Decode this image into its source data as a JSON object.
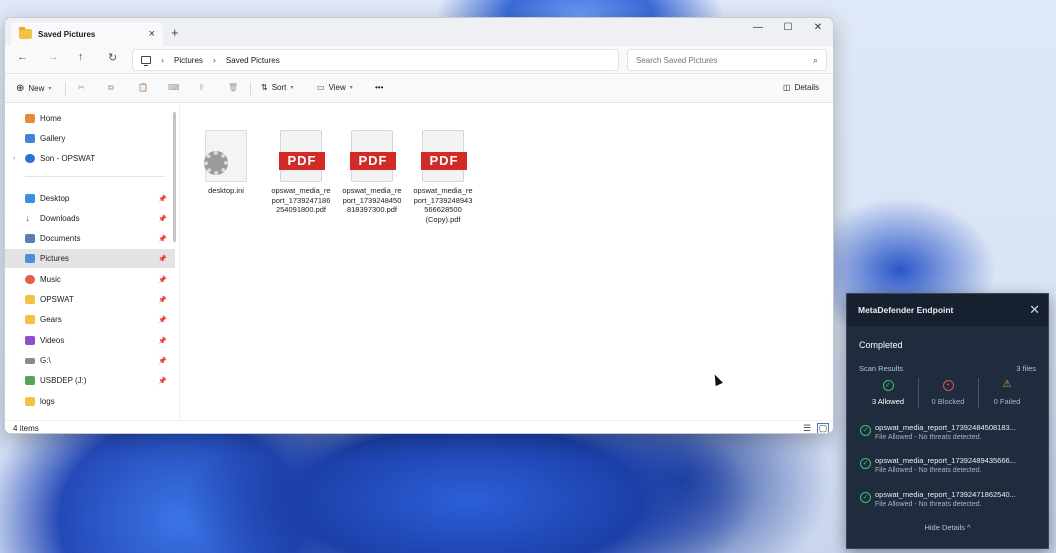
{
  "explorer": {
    "tab_title": "Saved Pictures",
    "new_tab_symbol": "+",
    "breadcrumb": [
      "Pictures",
      "Saved Pictures"
    ],
    "search_placeholder": "Search Saved Pictures",
    "toolbar": {
      "new_label": "New",
      "sort_label": "Sort",
      "view_label": "View",
      "more_label": "•••",
      "details_label": "Details"
    },
    "sidebar": {
      "top_items": [
        {
          "label": "Home",
          "icon": "home-icon"
        },
        {
          "label": "Gallery",
          "icon": "gallery-icon"
        },
        {
          "label": "Son - OPSWAT",
          "icon": "onedrive-cloud-icon"
        }
      ],
      "pinned_items": [
        {
          "label": "Desktop",
          "icon": "desktop-icon"
        },
        {
          "label": "Downloads",
          "icon": "download-icon"
        },
        {
          "label": "Documents",
          "icon": "documents-icon"
        },
        {
          "label": "Pictures",
          "icon": "pictures-icon"
        },
        {
          "label": "Music",
          "icon": "music-icon"
        },
        {
          "label": "OPSWAT",
          "icon": "folder-icon"
        },
        {
          "label": "Gears",
          "icon": "folder-icon"
        },
        {
          "label": "Videos",
          "icon": "videos-icon"
        },
        {
          "label": "G:\\",
          "icon": "drive-icon"
        },
        {
          "label": "USBDEP (J:)",
          "icon": "usb-drive-icon"
        },
        {
          "label": "logs",
          "icon": "folder-icon"
        }
      ],
      "active": "Pictures"
    },
    "files": [
      {
        "name": "desktop.ini",
        "type": "ini"
      },
      {
        "name": "opswat_media_report_1739247186254091800.pdf",
        "display": "opswat_media_re port_1739247186 254091800.pdf",
        "type": "pdf"
      },
      {
        "name": "opswat_media_report_1739248450818397300.pdf",
        "display": "opswat_media_re port_1739248450 818397300.pdf",
        "type": "pdf"
      },
      {
        "name": "opswat_media_report_1739248943566628500 (Copy).pdf",
        "display": "opswat_media_re port_1739248943 566628500 (Copy).pdf",
        "type": "pdf"
      }
    ],
    "pdf_badge": "PDF",
    "status_text": "4 items"
  },
  "metadefender": {
    "title": "MetaDefender Endpoint",
    "status": "Completed",
    "scan_results_label": "Scan Results",
    "files_count": "3 files",
    "stats": [
      {
        "label": "3 Allowed",
        "color": "#3cc36b"
      },
      {
        "label": "0 Blocked",
        "color": "#d9534f"
      },
      {
        "label": "0 Failed",
        "color": "#e8a33a"
      }
    ],
    "results": [
      {
        "file": "opswat_media_report_17392484508183...",
        "status": "File Allowed - No threats detected."
      },
      {
        "file": "opswat_media_report_17392489435666...",
        "status": "File Allowed - No threats detected."
      },
      {
        "file": "opswat_media_report_17392471862540...",
        "status": "File Allowed - No threats detected."
      }
    ],
    "hide_details": "Hide Details ^"
  }
}
